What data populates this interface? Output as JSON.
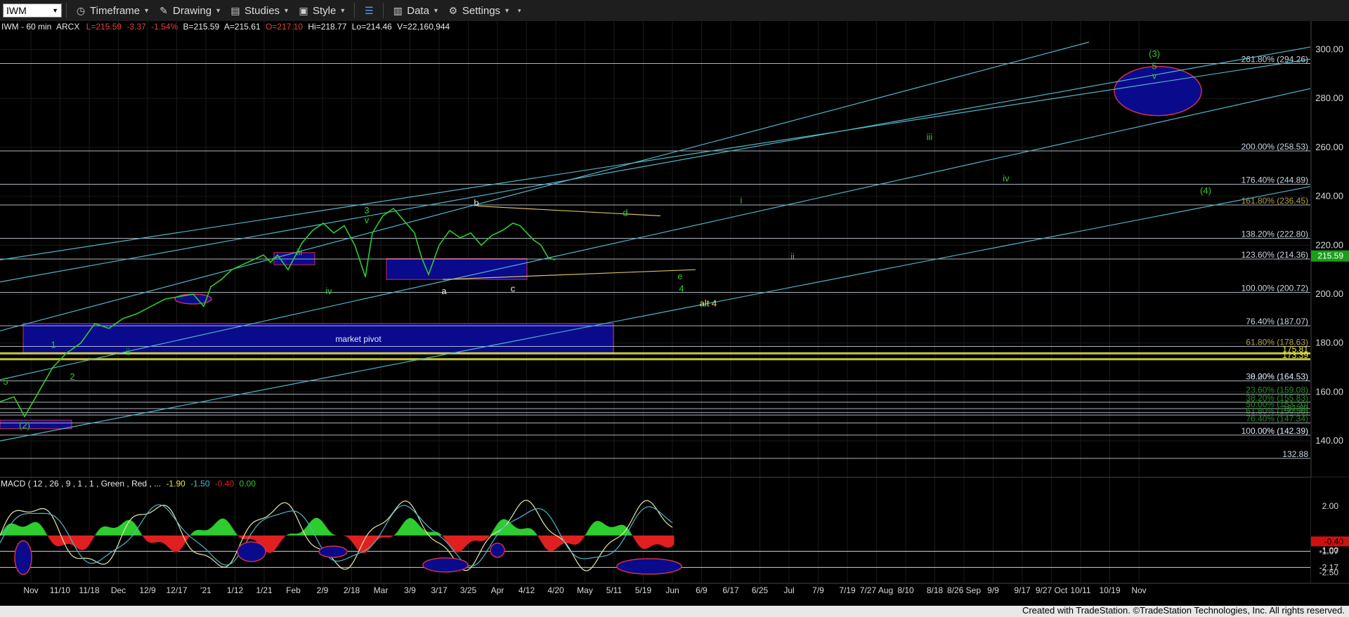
{
  "toolbar": {
    "symbol": "IWM",
    "timeframe_label": "Timeframe",
    "drawing_label": "Drawing",
    "studies_label": "Studies",
    "style_label": "Style",
    "data_label": "Data",
    "settings_label": "Settings"
  },
  "header": {
    "instrument": "IWM - 60 min",
    "exchange": "ARCX",
    "last": "L=215.59",
    "change": "-3.37",
    "pct_change": "-1.54%",
    "bid": "B=215.59",
    "ask": "A=215.61",
    "open": "O=217.10",
    "high": "Hi=218.77",
    "low": "Lo=214.46",
    "volume": "V=22,160,944"
  },
  "macd_header": {
    "label": "MACD ( 12 , 26 , 9 , 1 , 1 , Green , Red , ...",
    "v1": "-1.90",
    "v2": "-1.50",
    "v3": "-0.40",
    "v4": "0.00"
  },
  "footer": "Created with TradeStation. ©TradeStation Technologies, Inc. All rights reserved.",
  "colors": {
    "price": "#2ecc2e",
    "fib_line": "#c9d3e0",
    "channel": "#4fb6c8",
    "macd_pos": "#2ecc2e",
    "macd_neg": "#e02020",
    "box": "#0a0a8c",
    "box_border": "#d0304a",
    "yellow": "#e8e840",
    "last_price_bg": "#1a9e1a"
  },
  "chart_data": {
    "type": "line",
    "title": "IWM - 60 min",
    "ylim": [
      128,
      303
    ],
    "x_ticks": [
      "Nov",
      "11/10",
      "11/18",
      "Dec",
      "12/9",
      "12/17",
      "'21",
      "1/12",
      "1/21",
      "Feb",
      "2/9",
      "2/18",
      "Mar",
      "3/9",
      "3/17",
      "3/25",
      "Apr",
      "4/12",
      "4/20",
      "May",
      "5/11",
      "5/19",
      "Jun",
      "6/9",
      "6/17",
      "6/25",
      "Jul",
      "7/9",
      "7/19",
      "7/27 Aug",
      "8/10",
      "8/18",
      "8/26 Sep",
      "9/9",
      "9/17",
      "9/27 Oct",
      "10/11",
      "10/19",
      "Nov"
    ],
    "y_ticks": [
      140,
      160,
      180,
      200,
      220,
      240,
      260,
      280,
      300
    ],
    "price_path": [
      [
        0,
        156
      ],
      [
        20,
        158
      ],
      [
        35,
        150
      ],
      [
        55,
        160
      ],
      [
        75,
        170
      ],
      [
        95,
        176
      ],
      [
        115,
        180
      ],
      [
        135,
        188
      ],
      [
        155,
        186
      ],
      [
        175,
        190
      ],
      [
        195,
        192
      ],
      [
        215,
        195
      ],
      [
        235,
        198
      ],
      [
        255,
        199
      ],
      [
        275,
        200
      ],
      [
        290,
        195
      ],
      [
        300,
        203
      ],
      [
        315,
        206
      ],
      [
        330,
        210
      ],
      [
        345,
        212
      ],
      [
        360,
        214
      ],
      [
        375,
        216
      ],
      [
        385,
        213
      ],
      [
        395,
        216
      ],
      [
        410,
        210
      ],
      [
        430,
        221
      ],
      [
        445,
        226
      ],
      [
        460,
        229
      ],
      [
        475,
        225
      ],
      [
        490,
        228
      ],
      [
        505,
        220
      ],
      [
        520,
        207
      ],
      [
        530,
        225
      ],
      [
        545,
        232
      ],
      [
        560,
        235
      ],
      [
        575,
        230
      ],
      [
        590,
        225
      ],
      [
        600,
        215
      ],
      [
        610,
        208
      ],
      [
        625,
        220
      ],
      [
        640,
        226
      ],
      [
        655,
        223
      ],
      [
        670,
        225
      ],
      [
        685,
        220
      ],
      [
        700,
        224
      ],
      [
        715,
        226
      ],
      [
        730,
        229
      ],
      [
        740,
        228
      ],
      [
        750,
        225
      ],
      [
        760,
        222
      ],
      [
        770,
        220
      ],
      [
        780,
        215
      ],
      [
        790,
        214
      ]
    ],
    "fib_levels": [
      {
        "label": "261.80% (294.26)",
        "value": 294.26
      },
      {
        "label": "200.00% (258.53)",
        "value": 258.53
      },
      {
        "label": "176.40% (244.89)",
        "value": 244.89
      },
      {
        "label": "161.80% (236.45)",
        "value": 236.45
      },
      {
        "label": "138.20% (222.80)",
        "value": 222.8
      },
      {
        "label": "123.60% (214.36)",
        "value": 214.36
      },
      {
        "label": "100.00% (200.72)",
        "value": 200.72
      },
      {
        "label": "76.40% (187.07)",
        "value": 187.07
      },
      {
        "label": "61.80% (178.63)",
        "value": 178.63
      },
      {
        "label": "175.81",
        "value": 175.81
      },
      {
        "label": "173.39",
        "value": 173.39
      },
      {
        "label": "38.20% (164.53)",
        "value": 164.53
      },
      {
        "label": "0.00% (164.53)",
        "value": 164.53
      },
      {
        "label": "23.60% (159.08)",
        "value": 159.08
      },
      {
        "label": "38.20% (155.83)",
        "value": 155.83
      },
      {
        "label": "50.00% (153.20)",
        "value": 153.2
      },
      {
        "label": "61.80% (150.58)",
        "value": 150.58
      },
      {
        "label": "151.60",
        "value": 151.6
      },
      {
        "label": "76.40% (147.34)",
        "value": 147.34
      },
      {
        "label": "100.00% (142.39)",
        "value": 142.39
      },
      {
        "label": "0.00% (142.39)",
        "value": 142.39
      },
      {
        "label": "132.88",
        "value": 132.88
      }
    ],
    "last_price": "215.59",
    "wave_labels": [
      {
        "text": "(3)",
        "x": 1643,
        "y": 297
      },
      {
        "text": "5",
        "x": 1643,
        "y": 292
      },
      {
        "text": "v",
        "x": 1643,
        "y": 288
      },
      {
        "text": "iii",
        "x": 1323,
        "y": 263
      },
      {
        "text": "iv",
        "x": 1432,
        "y": 246
      },
      {
        "text": "(4)",
        "x": 1716,
        "y": 241
      },
      {
        "text": "i",
        "x": 1055,
        "y": 237
      },
      {
        "text": "ii",
        "x": 1128,
        "y": 214
      },
      {
        "text": "3",
        "x": 522,
        "y": 233
      },
      {
        "text": "v",
        "x": 522,
        "y": 229
      },
      {
        "text": "b",
        "x": 678,
        "y": 236
      },
      {
        "text": "d",
        "x": 890,
        "y": 232
      },
      {
        "text": "iii",
        "x": 426,
        "y": 216
      },
      {
        "text": "iv",
        "x": 468,
        "y": 200
      },
      {
        "text": "a",
        "x": 632,
        "y": 200
      },
      {
        "text": "c",
        "x": 730,
        "y": 201
      },
      {
        "text": "e",
        "x": 968,
        "y": 206
      },
      {
        "text": "4",
        "x": 970,
        "y": 201
      },
      {
        "text": "alt 4",
        "x": 1008,
        "y": 195
      },
      {
        "text": "1",
        "x": 76,
        "y": 178
      },
      {
        "text": "ii",
        "x": 182,
        "y": 175
      },
      {
        "text": "2",
        "x": 103,
        "y": 165
      },
      {
        "text": "5",
        "x": 8,
        "y": 163
      },
      {
        "text": "(2)",
        "x": 35,
        "y": 145
      }
    ],
    "annotations": [
      "market pivot"
    ],
    "macd": {
      "ylim": [
        -3.2,
        3.0
      ],
      "y_ticks": [
        "2.00",
        "-1.07",
        "-1.00",
        "-2.17",
        "-2.50"
      ],
      "last_value": "-0.40"
    }
  }
}
